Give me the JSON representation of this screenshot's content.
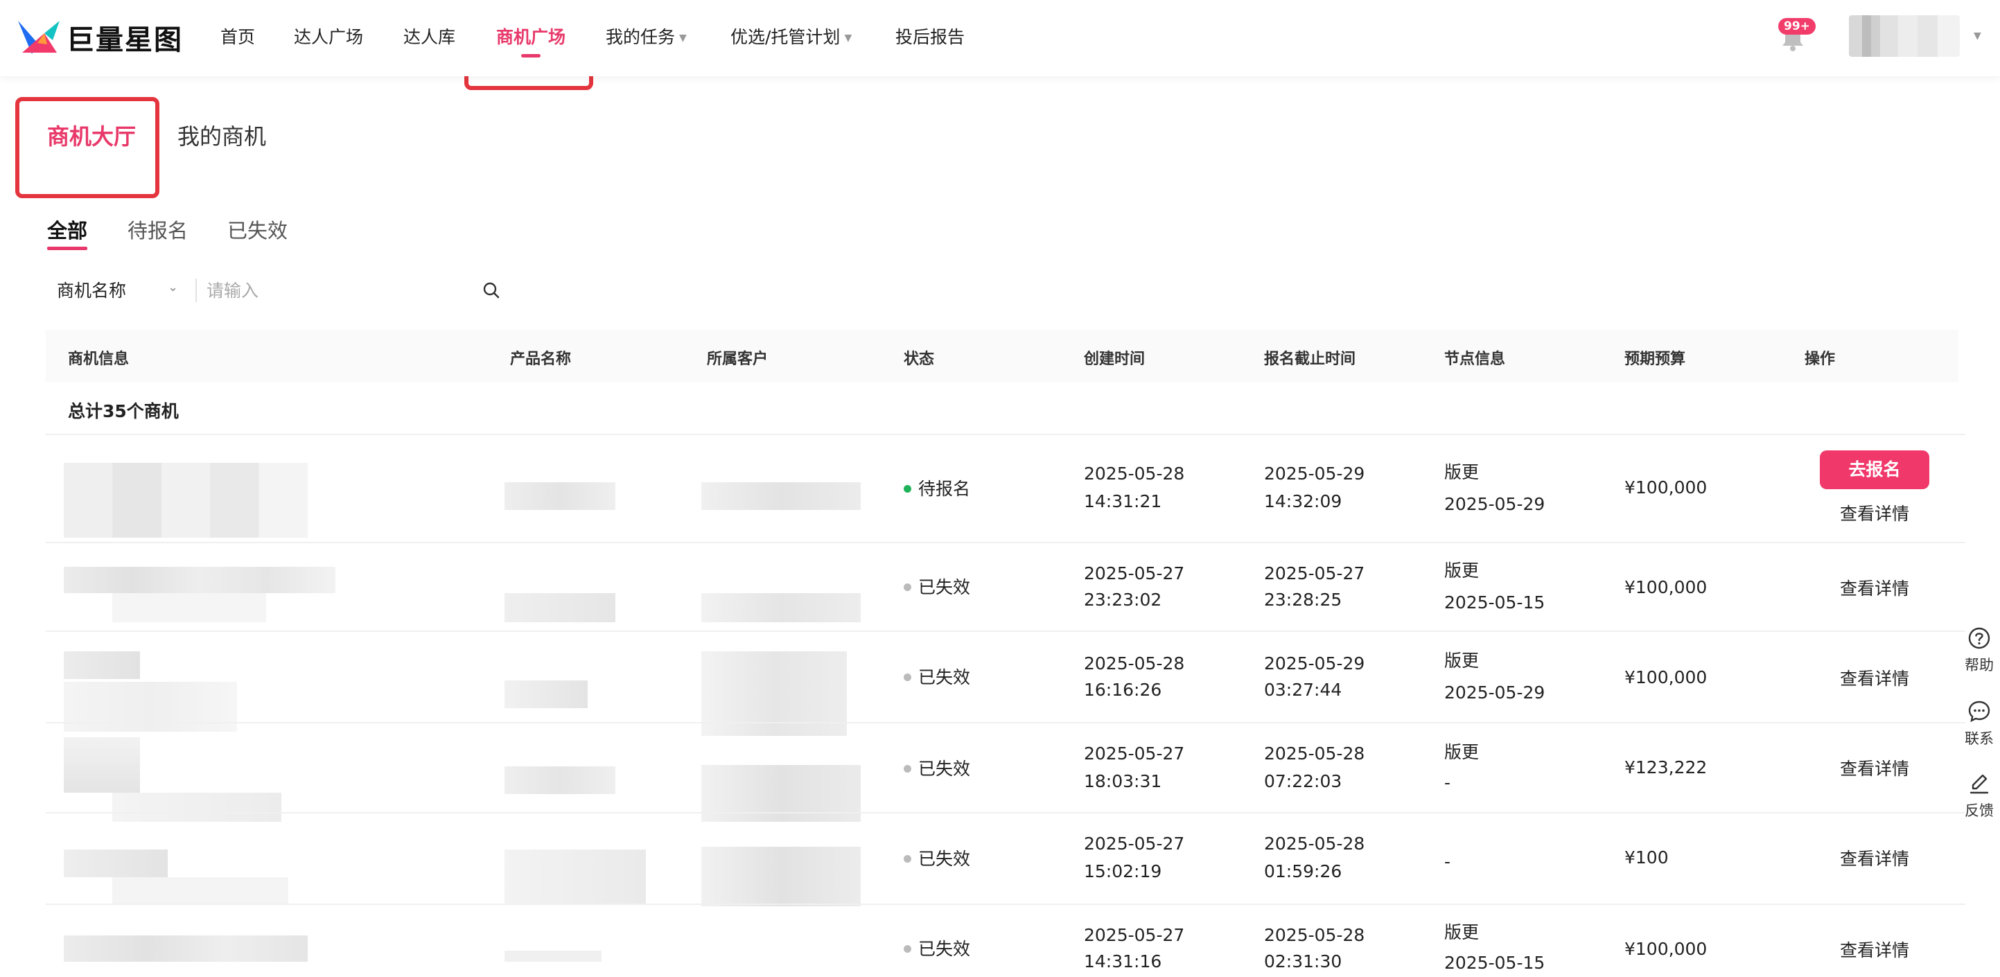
{
  "brand": {
    "name": "巨量星图"
  },
  "nav": {
    "items": [
      {
        "label": "首页"
      },
      {
        "label": "达人广场"
      },
      {
        "label": "达人库"
      },
      {
        "label": "商机广场"
      },
      {
        "label": "我的任务"
      },
      {
        "label": "优选/托管计划"
      },
      {
        "label": "投后报告"
      }
    ],
    "active_index": 3,
    "notification_badge": "99+"
  },
  "page_tabs": [
    {
      "label": "商机大厅"
    },
    {
      "label": "我的商机"
    }
  ],
  "sub_tabs": [
    {
      "label": "全部"
    },
    {
      "label": "待报名"
    },
    {
      "label": "已失效"
    }
  ],
  "filter": {
    "field": "商机名称",
    "placeholder": "请输入"
  },
  "table": {
    "headers": [
      "商机信息",
      "产品名称",
      "所属客户",
      "状态",
      "创建时间",
      "报名截止时间",
      "节点信息",
      "预期预算",
      "操作"
    ],
    "total": "总计35个商机",
    "rows": [
      {
        "status": "待报名",
        "created_date": "2025-05-28",
        "created_time": "14:31:21",
        "deadline_date": "2025-05-29",
        "deadline_time": "14:32:09",
        "node_title": "版更",
        "node_date": "2025-05-29",
        "budget": "¥100,000",
        "action": "去报名",
        "detail": "查看详情"
      },
      {
        "status": "已失效",
        "created_date": "2025-05-27",
        "created_time": "23:23:02",
        "deadline_date": "2025-05-27",
        "deadline_time": "23:28:25",
        "node_title": "版更",
        "node_date": "2025-05-15",
        "budget": "¥100,000",
        "detail": "查看详情"
      },
      {
        "status": "已失效",
        "created_date": "2025-05-28",
        "created_time": "16:16:26",
        "deadline_date": "2025-05-29",
        "deadline_time": "03:27:44",
        "node_title": "版更",
        "node_date": "2025-05-29",
        "budget": "¥100,000",
        "detail": "查看详情"
      },
      {
        "status": "已失效",
        "created_date": "2025-05-27",
        "created_time": "18:03:31",
        "deadline_date": "2025-05-28",
        "deadline_time": "07:22:03",
        "node_title": "版更",
        "node_date": "-",
        "budget": "¥123,222",
        "detail": "查看详情"
      },
      {
        "status": "已失效",
        "created_date": "2025-05-27",
        "created_time": "15:02:19",
        "deadline_date": "2025-05-28",
        "deadline_time": "01:59:26",
        "node_title": "-",
        "node_date": "",
        "budget": "¥100",
        "detail": "查看详情"
      },
      {
        "status": "已失效",
        "created_date": "2025-05-27",
        "created_time": "14:31:16",
        "deadline_date": "2025-05-28",
        "deadline_time": "02:31:30",
        "node_title": "版更",
        "node_date": "2025-05-15",
        "budget": "¥100,000",
        "detail": "查看详情"
      }
    ]
  },
  "side_float": [
    {
      "label": "帮助",
      "icon": "help-icon"
    },
    {
      "label": "联系",
      "icon": "chat-icon"
    },
    {
      "label": "反馈",
      "icon": "edit-icon"
    }
  ],
  "colors": {
    "accent": "#e8396a",
    "highlight_box": "#e4353e",
    "status_active": "#1fb25a",
    "status_inactive": "#bbbbbb"
  }
}
